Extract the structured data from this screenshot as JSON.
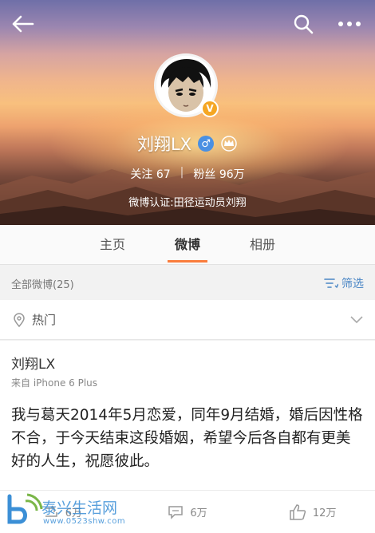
{
  "header": {
    "profile_name": "刘翔LX",
    "vip_badge": "V",
    "gender_symbol": "♂",
    "following_label": "关注",
    "following_count": "67",
    "followers_label": "粉丝",
    "followers_count": "96万",
    "stat_separator": "|",
    "verification": "微博认证:田径运动员刘翔",
    "icons": [
      "back-arrow-icon",
      "search-icon",
      "more-icon",
      "crown-icon"
    ]
  },
  "tabs": [
    {
      "label": "主页",
      "active": false
    },
    {
      "label": "微博",
      "active": true
    },
    {
      "label": "相册",
      "active": false
    }
  ],
  "filterbar": {
    "count_label": "全部微博(25)",
    "filter_label": "筛选"
  },
  "hot": {
    "label": "热门"
  },
  "post": {
    "author": "刘翔LX",
    "source": "来自 iPhone 6 Plus",
    "content": "我与葛天2014年5月恋爱，同年9月结婚，婚后因性格不合，于今天结束这段婚姻，希望今后各自都有更美好的人生，祝愿彼此。",
    "repost_count": "6万",
    "comment_count": "6万",
    "like_count": "12万"
  },
  "watermark": {
    "text": "泰兴生活网",
    "url": "www.0523shw.com"
  },
  "colors": {
    "accent": "#fa7d3c",
    "link": "#4a86c5",
    "badge": "#f5a623",
    "gender": "#4a90e2"
  }
}
